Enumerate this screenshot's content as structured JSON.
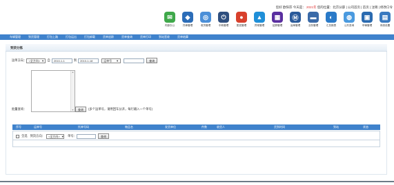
{
  "header": {
    "links": [
      "您好 欧阳芬",
      "今天是：",
      "2021年",
      "您的位置：北京分部",
      "公司首页",
      "首页",
      "注销",
      "修改口令"
    ],
    "icons": [
      {
        "name": "office-icon",
        "label": "内部办公",
        "color": "#3fa84a",
        "glyph": "✉"
      },
      {
        "name": "customer-icon",
        "label": "托单管理",
        "color": "#2c6db8",
        "glyph": "◆"
      },
      {
        "name": "collect-icon",
        "label": "收货管理",
        "color": "#4b8fd8",
        "glyph": "◎"
      },
      {
        "name": "power-icon",
        "label": "中转管理",
        "color": "#2f4f7f",
        "glyph": "⏻"
      },
      {
        "name": "dispatch-icon",
        "label": "配送管理",
        "color": "#d8402c",
        "glyph": "●"
      },
      {
        "name": "finance-icon",
        "label": "异常管理",
        "color": "#1f8fd8",
        "glyph": "▲"
      },
      {
        "name": "report-icon",
        "label": "结算管理",
        "color": "#5a2fa0",
        "glyph": "▦"
      },
      {
        "name": "stats-icon",
        "label": "运单管理",
        "color": "#2a5a9a",
        "glyph": "Ⓜ"
      },
      {
        "name": "card-icon",
        "label": "业务管理",
        "color": "#3a6aa8",
        "glyph": "▬"
      },
      {
        "name": "query-icon",
        "label": "汇总报表",
        "color": "#2a7ac8",
        "glyph": "◐"
      },
      {
        "name": "globe-icon",
        "label": "公共查询",
        "color": "#4a9adf",
        "glyph": "◍"
      },
      {
        "name": "system-icon",
        "label": "车辆管理",
        "color": "#2a6ab0",
        "glyph": "▣"
      },
      {
        "name": "settings-icon",
        "label": "系统设置",
        "color": "#3a7ac0",
        "glyph": "▤"
      }
    ]
  },
  "nav": [
    "车辆管理",
    "到货管理",
    "打包上路",
    "打包运出",
    "打包卸载",
    "货单追踪",
    "货单查询",
    "货单打印",
    "到站签收",
    "货单结算"
  ],
  "panel_title": "到货分拣",
  "filter": {
    "label": "运单方向：",
    "direction": "<全方向>",
    "from_label": "自",
    "date_from": "2010-1-1",
    "to_label": "到",
    "date_to": "2010-1-18",
    "field": "运单号",
    "value": "",
    "button": "查询"
  },
  "batch": {
    "label": "批量查询：",
    "button": "查询",
    "hint": "(多个运单号，请用回车分开，每行输入一个单号)"
  },
  "table": {
    "headers": [
      "序号",
      "运单号",
      "托单号码",
      "物品名",
      "发货单位",
      "件数",
      "收货人",
      "货到时间",
      "到站",
      "状态"
    ],
    "row": {
      "select_all": "全选",
      "direction_label": "到货方向：",
      "direction": "<全方向>",
      "order_label": "单号：",
      "button": "查询"
    }
  }
}
